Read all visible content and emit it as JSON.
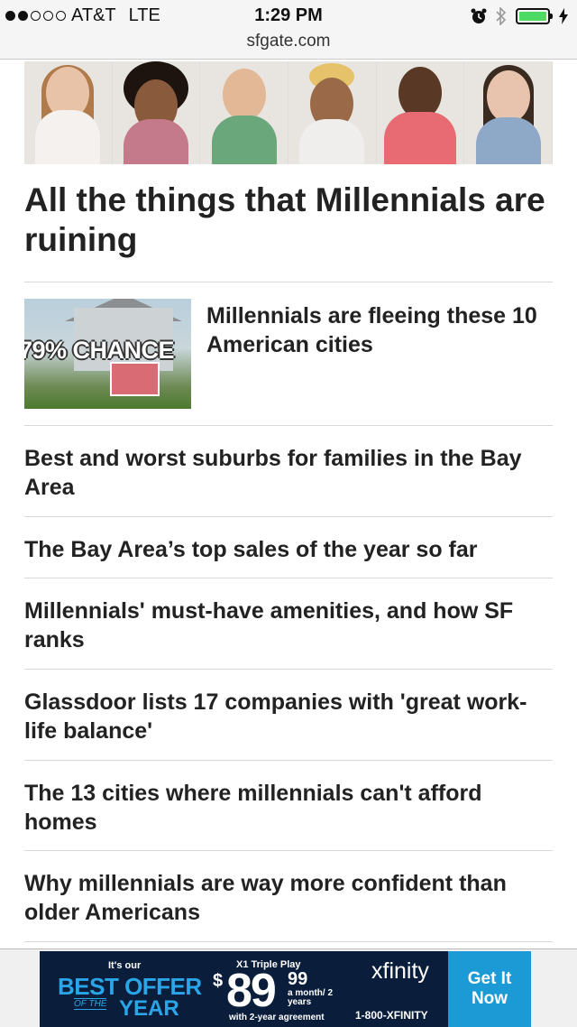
{
  "status_bar": {
    "carrier": "AT&T",
    "network": "LTE",
    "time": "1:29 PM",
    "signal_bars_filled": 2,
    "signal_bars_total": 5,
    "battery_level": 1.0,
    "icons": [
      "alarm-icon",
      "bluetooth-icon",
      "battery-icon",
      "charging-icon"
    ]
  },
  "url_bar": {
    "domain": "sfgate.com"
  },
  "article": {
    "headline": "All the things that Millennials are ruining"
  },
  "feature_story": {
    "title": "Millennials are fleeing these 10 American cities",
    "image_overlay_text": "79% CHANCE"
  },
  "stories": [
    "Best and worst suburbs for families in the Bay Area",
    "The Bay Area’s top sales of the year so far",
    "Millennials' must-have amenities, and how SF ranks",
    "Glassdoor lists 17 companies with 'great work-life balance'",
    "The 13 cities where millennials can't afford homes",
    "Why millennials are way more confident than older Americans"
  ],
  "ad": {
    "intro": "It's our",
    "best_offer": "BEST OFFER",
    "of_the": "OF THE",
    "year": "YEAR",
    "product": "X1 Triple Play",
    "dollar_sign": "$",
    "price": "89",
    "cents": "99",
    "term": "a month/ 2 years",
    "agreement": "with 2-year agreement",
    "brand": "xfinity",
    "phone": "1-800-XFINITY",
    "cta": "Get It Now"
  },
  "colors": {
    "ad_background": "#0a1e3c",
    "ad_accent": "#2aa6e8",
    "cta_background": "#1b9ad6",
    "battery": "#4cd964"
  }
}
